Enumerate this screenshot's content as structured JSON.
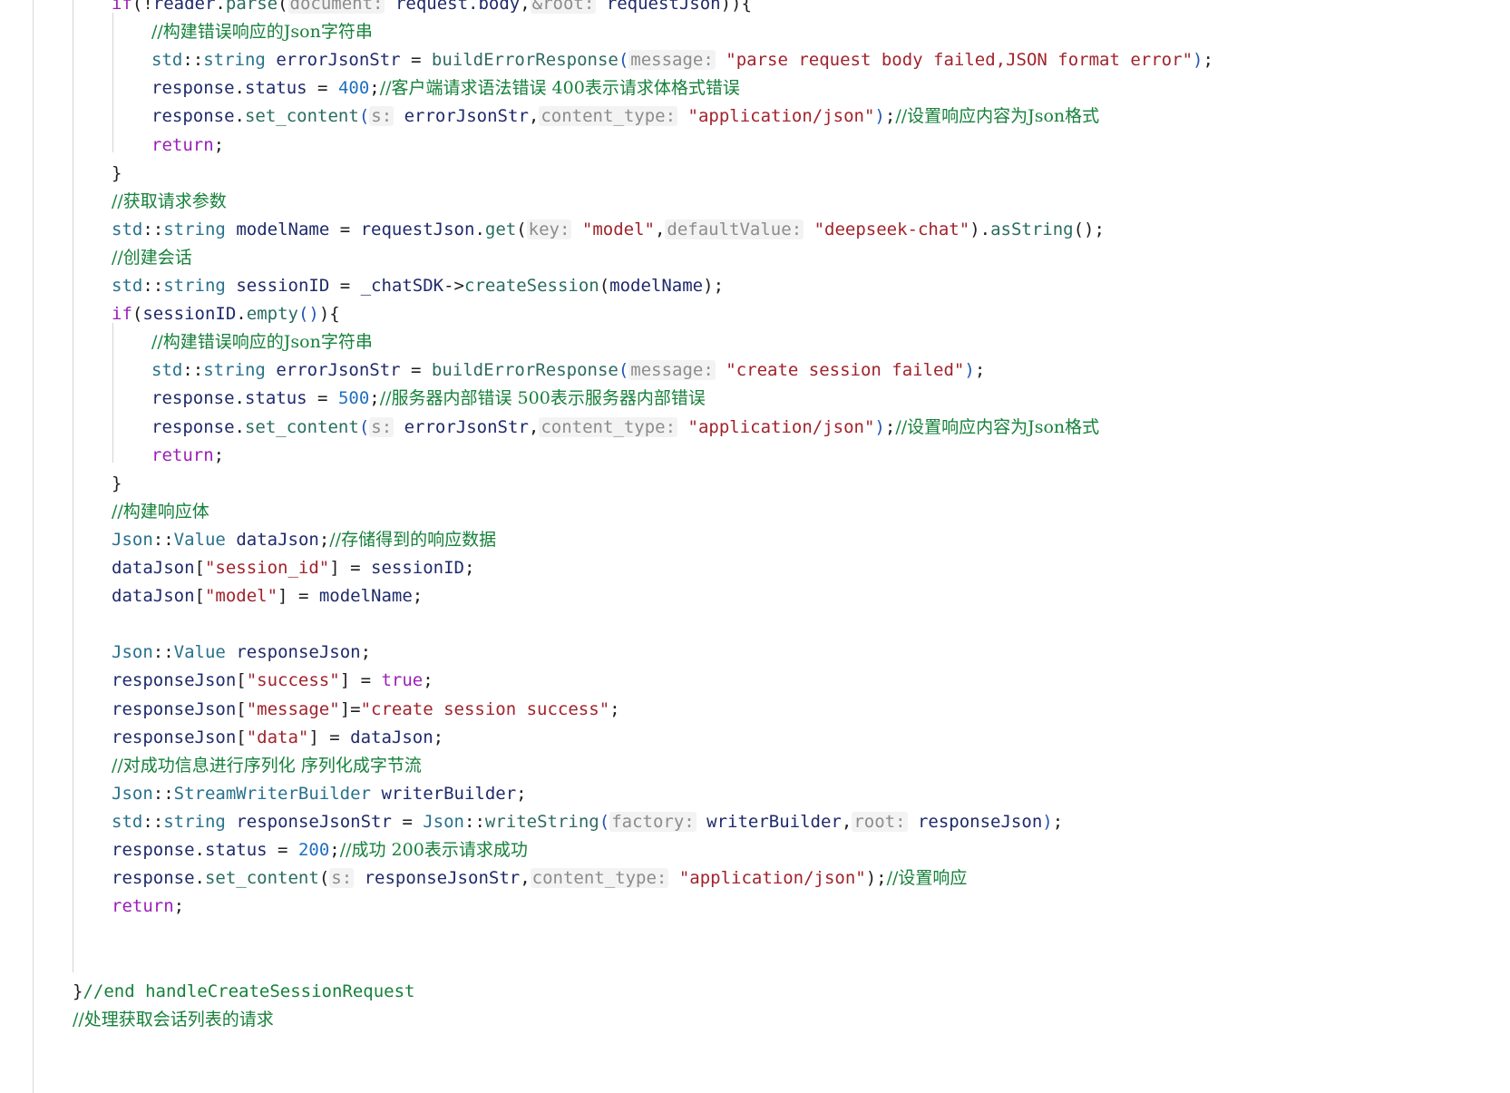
{
  "editor": {
    "language": "cpp",
    "lines": [
      {
        "indent": 1,
        "tokens": [
          [
            "kw",
            "if"
          ],
          [
            "punct",
            "(!"
          ],
          [
            "ident",
            "reader"
          ],
          [
            "punct",
            "."
          ],
          [
            "method",
            "parse"
          ],
          [
            "punct",
            "("
          ],
          [
            "hint",
            "document:"
          ],
          [
            "plain",
            " "
          ],
          [
            "ident",
            "request.body"
          ],
          [
            "punct",
            ","
          ],
          [
            "hint",
            "&root:"
          ],
          [
            "plain",
            " "
          ],
          [
            "ident",
            "requestJson"
          ],
          [
            "punct",
            "))"
          ],
          [
            "punct",
            "{"
          ]
        ]
      },
      {
        "indent": 2,
        "tokens": [
          [
            "comment",
            "//构建错误响应的Json字符串"
          ]
        ]
      },
      {
        "indent": 2,
        "tokens": [
          [
            "type",
            "std"
          ],
          [
            "punct",
            "::"
          ],
          [
            "type",
            "string"
          ],
          [
            "plain",
            " "
          ],
          [
            "ident",
            "errorJsonStr"
          ],
          [
            "plain",
            " = "
          ],
          [
            "func",
            "buildErrorResponse"
          ],
          [
            "paren",
            "("
          ],
          [
            "hint",
            "message:"
          ],
          [
            "plain",
            " "
          ],
          [
            "str",
            "\"parse request body failed,JSON format error\""
          ],
          [
            "paren",
            ")"
          ],
          [
            "punct",
            ";"
          ]
        ]
      },
      {
        "indent": 2,
        "tokens": [
          [
            "ident",
            "response"
          ],
          [
            "punct",
            "."
          ],
          [
            "ident",
            "status"
          ],
          [
            "plain",
            " = "
          ],
          [
            "num",
            "400"
          ],
          [
            "punct",
            ";"
          ],
          [
            "comment",
            "//客户端请求语法错误 400表示请求体格式错误"
          ]
        ]
      },
      {
        "indent": 2,
        "tokens": [
          [
            "ident",
            "response"
          ],
          [
            "punct",
            "."
          ],
          [
            "method",
            "set_content"
          ],
          [
            "paren",
            "("
          ],
          [
            "hint",
            "s:"
          ],
          [
            "plain",
            " "
          ],
          [
            "ident",
            "errorJsonStr"
          ],
          [
            "punct",
            ","
          ],
          [
            "hint",
            "content_type:"
          ],
          [
            "plain",
            " "
          ],
          [
            "str",
            "\"application/json\""
          ],
          [
            "paren",
            ")"
          ],
          [
            "punct",
            ";"
          ],
          [
            "comment",
            "//设置响应内容为Json格式"
          ]
        ]
      },
      {
        "indent": 2,
        "tokens": [
          [
            "kw",
            "return"
          ],
          [
            "punct",
            ";"
          ]
        ]
      },
      {
        "indent": 1,
        "tokens": [
          [
            "punct",
            "}"
          ]
        ]
      },
      {
        "indent": 1,
        "tokens": [
          [
            "comment",
            "//获取请求参数"
          ]
        ]
      },
      {
        "indent": 1,
        "tokens": [
          [
            "type",
            "std"
          ],
          [
            "punct",
            "::"
          ],
          [
            "type",
            "string"
          ],
          [
            "plain",
            " "
          ],
          [
            "ident",
            "modelName"
          ],
          [
            "plain",
            " = "
          ],
          [
            "ident",
            "requestJson"
          ],
          [
            "punct",
            "."
          ],
          [
            "method",
            "get"
          ],
          [
            "punct",
            "("
          ],
          [
            "hint",
            "key:"
          ],
          [
            "plain",
            " "
          ],
          [
            "str",
            "\"model\""
          ],
          [
            "punct",
            ","
          ],
          [
            "hint",
            "defaultValue:"
          ],
          [
            "plain",
            " "
          ],
          [
            "str",
            "\"deepseek-chat\""
          ],
          [
            "punct",
            ")."
          ],
          [
            "method",
            "asString"
          ],
          [
            "punct",
            "();"
          ]
        ]
      },
      {
        "indent": 1,
        "tokens": [
          [
            "comment",
            "//创建会话"
          ]
        ]
      },
      {
        "indent": 1,
        "tokens": [
          [
            "type",
            "std"
          ],
          [
            "punct",
            "::"
          ],
          [
            "type",
            "string"
          ],
          [
            "plain",
            " "
          ],
          [
            "ident",
            "sessionID"
          ],
          [
            "plain",
            " = "
          ],
          [
            "ident",
            "_chatSDK"
          ],
          [
            "punct",
            "->"
          ],
          [
            "method",
            "createSession"
          ],
          [
            "punct",
            "("
          ],
          [
            "ident",
            "modelName"
          ],
          [
            "punct",
            ");"
          ]
        ]
      },
      {
        "indent": 1,
        "tokens": [
          [
            "kw",
            "if"
          ],
          [
            "punct",
            "("
          ],
          [
            "ident",
            "sessionID"
          ],
          [
            "punct",
            "."
          ],
          [
            "method",
            "empty"
          ],
          [
            "paren",
            "()"
          ],
          [
            "punct",
            "){"
          ]
        ]
      },
      {
        "indent": 2,
        "tokens": [
          [
            "comment",
            "//构建错误响应的Json字符串"
          ]
        ]
      },
      {
        "indent": 2,
        "tokens": [
          [
            "type",
            "std"
          ],
          [
            "punct",
            "::"
          ],
          [
            "type",
            "string"
          ],
          [
            "plain",
            " "
          ],
          [
            "ident",
            "errorJsonStr"
          ],
          [
            "plain",
            " = "
          ],
          [
            "func",
            "buildErrorResponse"
          ],
          [
            "paren",
            "("
          ],
          [
            "hint",
            "message:"
          ],
          [
            "plain",
            " "
          ],
          [
            "str",
            "\"create session failed\""
          ],
          [
            "paren",
            ")"
          ],
          [
            "punct",
            ";"
          ]
        ]
      },
      {
        "indent": 2,
        "tokens": [
          [
            "ident",
            "response"
          ],
          [
            "punct",
            "."
          ],
          [
            "ident",
            "status"
          ],
          [
            "plain",
            " = "
          ],
          [
            "num",
            "500"
          ],
          [
            "punct",
            ";"
          ],
          [
            "comment",
            "//服务器内部错误 500表示服务器内部错误"
          ]
        ]
      },
      {
        "indent": 2,
        "tokens": [
          [
            "ident",
            "response"
          ],
          [
            "punct",
            "."
          ],
          [
            "method",
            "set_content"
          ],
          [
            "paren",
            "("
          ],
          [
            "hint",
            "s:"
          ],
          [
            "plain",
            " "
          ],
          [
            "ident",
            "errorJsonStr"
          ],
          [
            "punct",
            ","
          ],
          [
            "hint",
            "content_type:"
          ],
          [
            "plain",
            " "
          ],
          [
            "str",
            "\"application/json\""
          ],
          [
            "paren",
            ")"
          ],
          [
            "punct",
            ";"
          ],
          [
            "comment",
            "//设置响应内容为Json格式"
          ]
        ]
      },
      {
        "indent": 2,
        "tokens": [
          [
            "kw",
            "return"
          ],
          [
            "punct",
            ";"
          ]
        ]
      },
      {
        "indent": 1,
        "tokens": [
          [
            "punct",
            "}"
          ]
        ]
      },
      {
        "indent": 1,
        "tokens": [
          [
            "comment",
            "//构建响应体"
          ]
        ]
      },
      {
        "indent": 1,
        "tokens": [
          [
            "type",
            "Json"
          ],
          [
            "punct",
            "::"
          ],
          [
            "type",
            "Value"
          ],
          [
            "plain",
            " "
          ],
          [
            "ident",
            "dataJson"
          ],
          [
            "punct",
            ";"
          ],
          [
            "comment",
            "//存储得到的响应数据"
          ]
        ]
      },
      {
        "indent": 1,
        "tokens": [
          [
            "ident",
            "dataJson"
          ],
          [
            "punct",
            "["
          ],
          [
            "str",
            "\"session_id\""
          ],
          [
            "punct",
            "]"
          ],
          [
            "plain",
            " = "
          ],
          [
            "ident",
            "sessionID"
          ],
          [
            "punct",
            ";"
          ]
        ]
      },
      {
        "indent": 1,
        "tokens": [
          [
            "ident",
            "dataJson"
          ],
          [
            "punct",
            "["
          ],
          [
            "str",
            "\"model\""
          ],
          [
            "punct",
            "]"
          ],
          [
            "plain",
            " = "
          ],
          [
            "ident",
            "modelName"
          ],
          [
            "punct",
            ";"
          ]
        ]
      },
      {
        "indent": 1,
        "tokens": []
      },
      {
        "indent": 1,
        "tokens": [
          [
            "type",
            "Json"
          ],
          [
            "punct",
            "::"
          ],
          [
            "type",
            "Value"
          ],
          [
            "plain",
            " "
          ],
          [
            "ident",
            "responseJson"
          ],
          [
            "punct",
            ";"
          ]
        ]
      },
      {
        "indent": 1,
        "tokens": [
          [
            "ident",
            "responseJson"
          ],
          [
            "punct",
            "["
          ],
          [
            "str",
            "\"success\""
          ],
          [
            "punct",
            "]"
          ],
          [
            "plain",
            " = "
          ],
          [
            "kw",
            "true"
          ],
          [
            "punct",
            ";"
          ]
        ]
      },
      {
        "indent": 1,
        "tokens": [
          [
            "ident",
            "responseJson"
          ],
          [
            "punct",
            "["
          ],
          [
            "str",
            "\"message\""
          ],
          [
            "punct",
            "]"
          ],
          [
            "plain",
            "="
          ],
          [
            "str",
            "\"create session success\""
          ],
          [
            "punct",
            ";"
          ]
        ]
      },
      {
        "indent": 1,
        "tokens": [
          [
            "ident",
            "responseJson"
          ],
          [
            "punct",
            "["
          ],
          [
            "str",
            "\"data\""
          ],
          [
            "punct",
            "]"
          ],
          [
            "plain",
            " = "
          ],
          [
            "ident",
            "dataJson"
          ],
          [
            "punct",
            ";"
          ]
        ]
      },
      {
        "indent": 1,
        "tokens": [
          [
            "comment",
            "//对成功信息进行序列化 序列化成字节流"
          ]
        ]
      },
      {
        "indent": 1,
        "tokens": [
          [
            "type",
            "Json"
          ],
          [
            "punct",
            "::"
          ],
          [
            "type",
            "StreamWriterBuilder"
          ],
          [
            "plain",
            " "
          ],
          [
            "ident",
            "writerBuilder"
          ],
          [
            "punct",
            ";"
          ]
        ]
      },
      {
        "indent": 1,
        "tokens": [
          [
            "type",
            "std"
          ],
          [
            "punct",
            "::"
          ],
          [
            "type",
            "string"
          ],
          [
            "plain",
            " "
          ],
          [
            "ident",
            "responseJsonStr"
          ],
          [
            "plain",
            " = "
          ],
          [
            "type",
            "Json"
          ],
          [
            "punct",
            "::"
          ],
          [
            "func",
            "writeString"
          ],
          [
            "paren",
            "("
          ],
          [
            "hint",
            "factory:"
          ],
          [
            "plain",
            " "
          ],
          [
            "ident",
            "writerBuilder"
          ],
          [
            "punct",
            ","
          ],
          [
            "hint",
            "root:"
          ],
          [
            "plain",
            " "
          ],
          [
            "ident",
            "responseJson"
          ],
          [
            "paren",
            ")"
          ],
          [
            "punct",
            ";"
          ]
        ]
      },
      {
        "indent": 1,
        "tokens": [
          [
            "ident",
            "response"
          ],
          [
            "punct",
            "."
          ],
          [
            "ident",
            "status"
          ],
          [
            "plain",
            " = "
          ],
          [
            "num",
            "200"
          ],
          [
            "punct",
            ";"
          ],
          [
            "comment",
            "//成功 200表示请求成功"
          ]
        ]
      },
      {
        "indent": 1,
        "tokens": [
          [
            "ident",
            "response"
          ],
          [
            "punct",
            "."
          ],
          [
            "method",
            "set_content"
          ],
          [
            "punct",
            "("
          ],
          [
            "hint",
            "s:"
          ],
          [
            "plain",
            " "
          ],
          [
            "ident",
            "responseJsonStr"
          ],
          [
            "punct",
            ","
          ],
          [
            "hint",
            "content_type:"
          ],
          [
            "plain",
            " "
          ],
          [
            "str",
            "\"application/json\""
          ],
          [
            "punct",
            ");"
          ],
          [
            "comment",
            "//设置响应"
          ]
        ]
      },
      {
        "indent": 1,
        "tokens": [
          [
            "kw",
            "return"
          ],
          [
            "punct",
            ";"
          ]
        ]
      },
      {
        "indent": 1,
        "tokens": []
      },
      {
        "indent": 1,
        "tokens": []
      },
      {
        "indent": 0,
        "tokens": [
          [
            "punct",
            "}"
          ],
          [
            "comment",
            "//end handleCreateSessionRequest"
          ]
        ]
      },
      {
        "indent": 0,
        "tokens": [
          [
            "comment",
            "//处理获取会话列表的请求"
          ]
        ]
      }
    ]
  }
}
